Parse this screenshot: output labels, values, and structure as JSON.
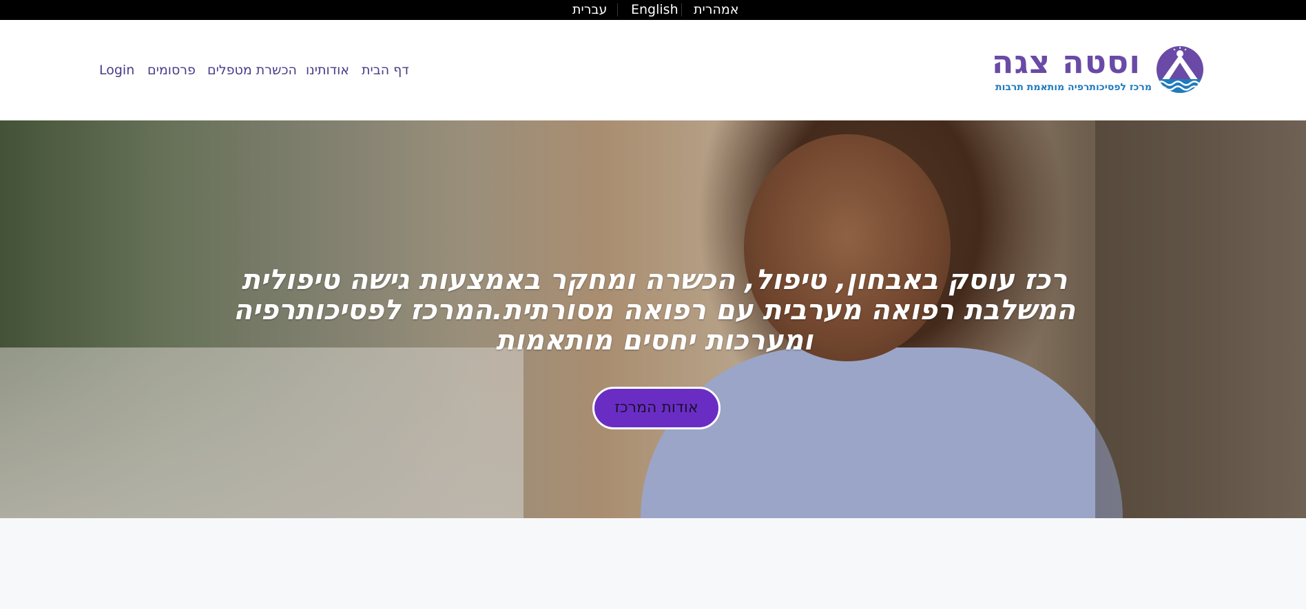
{
  "language_bar": {
    "hebrew": "עברית",
    "english": "English",
    "amharic": "אמהרית"
  },
  "logo": {
    "name": "וסטה צגה",
    "tagline": "מרכז לפסיכותרפיה מותאמת תרבות",
    "emblem_icon": "mountain-sun-waves-icon"
  },
  "nav": {
    "login": "Login",
    "publications": "פרסומים",
    "training": "הכשרת מטפלים",
    "about": "אודותינו",
    "home": "דף הבית"
  },
  "hero": {
    "headline": "רכז עוסק באבחון, טיפול, הכשרה ומחקר באמצעות גישה טיפולית המשלבת רפואה מערבית עם רפואה מסורתית.המרכז לפסיכותרפיה ומערכות יחסים מותאמות",
    "button_label": "אודות המרכז"
  },
  "colors": {
    "brand_purple": "#6a4aa6",
    "brand_blue": "#1f7bbd",
    "button_purple": "#6a2dc4",
    "nav_text": "#4a3a8a"
  }
}
